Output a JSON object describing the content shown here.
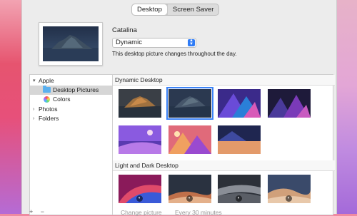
{
  "tabs": [
    {
      "label": "Desktop",
      "active": true
    },
    {
      "label": "Screen Saver",
      "active": false
    }
  ],
  "wallpaper": {
    "name": "Catalina",
    "mode": "Dynamic",
    "description": "This desktop picture changes throughout the day."
  },
  "sidebar": {
    "items": [
      {
        "label": "Apple",
        "expanded": true
      },
      {
        "label": "Desktop Pictures",
        "selected": true,
        "icon": "folder-icon"
      },
      {
        "label": "Colors",
        "icon": "colors-icon"
      },
      {
        "label": "Photos",
        "expanded": false
      },
      {
        "label": "Folders",
        "expanded": false
      }
    ]
  },
  "sections": [
    {
      "title": "Dynamic Desktop",
      "thumb_count": 7,
      "selected_index": 1
    },
    {
      "title": "Light and Dark Desktop",
      "thumb_count": 4
    }
  ],
  "footer": {
    "add_label": "+",
    "remove_label": "−",
    "change_picture_label": "Change picture",
    "interval_label": "Every 30 minutes"
  },
  "colors": {
    "accent": "#3b82f6",
    "window_bg": "#ececec"
  }
}
